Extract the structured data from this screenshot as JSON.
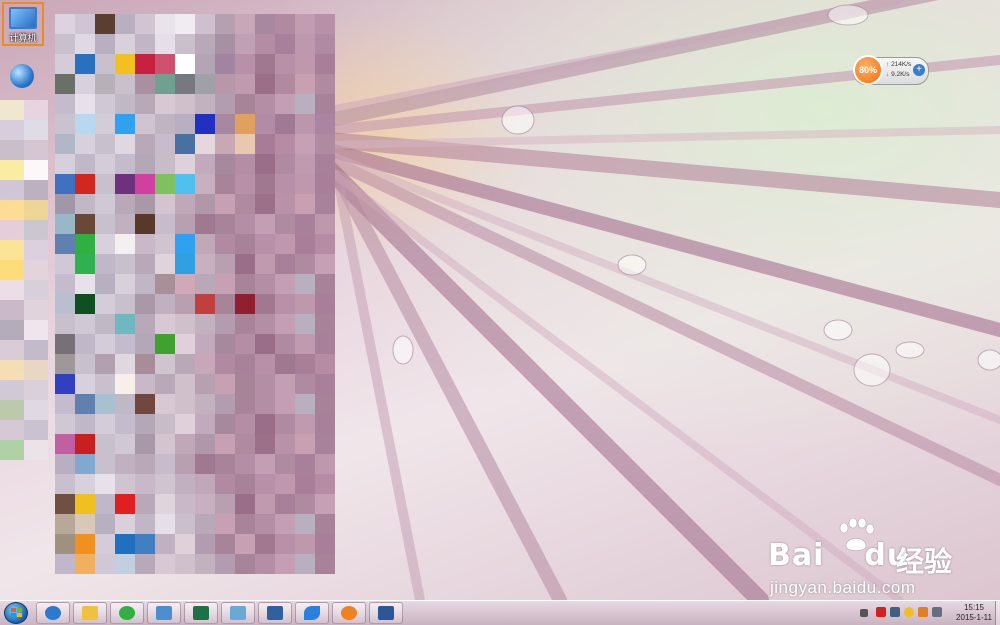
{
  "desktop": {
    "icons": [
      {
        "name": "computer",
        "label": "计算机",
        "selected": true
      },
      {
        "name": "network",
        "label": ""
      }
    ],
    "selection_color": "#f28a1a"
  },
  "net_widget": {
    "percent": "80%",
    "upload": "214K/s",
    "download": "9.2K/s",
    "accent": "#f07010"
  },
  "watermark": {
    "brand": "Bai",
    "brand_tail": "du",
    "chinese": "经验",
    "url": "jingyan.baidu.com"
  },
  "taskbar": {
    "start_icon": "windows-start-orb",
    "pinned": [
      {
        "name": "ie-browser",
        "color": "#2a7ad0"
      },
      {
        "name": "file-explorer",
        "color": "#f0c040"
      },
      {
        "name": "sync-app",
        "color": "#30b040"
      },
      {
        "name": "computer-window",
        "color": "#4a90d0"
      },
      {
        "name": "excel",
        "color": "#1e7145"
      },
      {
        "name": "window-app",
        "color": "#6aa8d8"
      },
      {
        "name": "disk-tool",
        "color": "#3060a0"
      },
      {
        "name": "messenger",
        "color": "#2a80e0"
      },
      {
        "name": "fruit-app",
        "color": "#f08020"
      },
      {
        "name": "word",
        "color": "#2b579a"
      }
    ],
    "clock": {
      "time": "15:15",
      "date": "2015-1-11"
    }
  }
}
